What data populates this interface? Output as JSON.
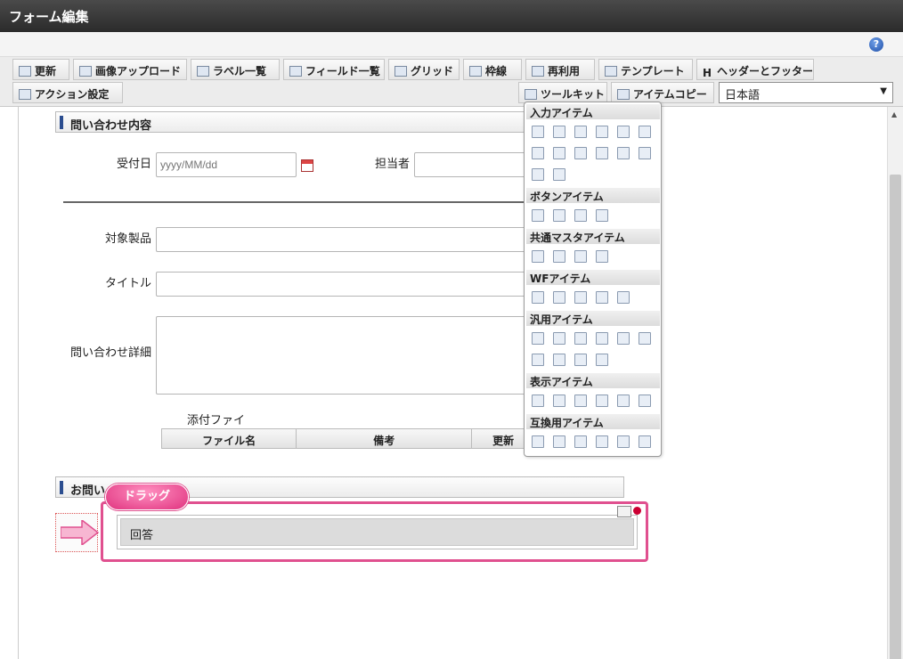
{
  "window": {
    "title": "フォーム編集"
  },
  "toolbar": {
    "row1": [
      {
        "label": "更新",
        "icon": "refresh-icon"
      },
      {
        "label": "画像アップロード",
        "icon": "image-upload-icon"
      },
      {
        "label": "ラベル一覧",
        "icon": "label-list-icon"
      },
      {
        "label": "フィールド一覧",
        "icon": "field-list-icon"
      },
      {
        "label": "グリッド",
        "icon": "grid-icon"
      },
      {
        "label": "枠線",
        "icon": "border-icon"
      },
      {
        "label": "再利用",
        "icon": "reuse-icon"
      },
      {
        "label": "テンプレート",
        "icon": "template-icon"
      },
      {
        "label": "ヘッダーとフッター",
        "icon": "header-footer-icon"
      }
    ],
    "row2_left": {
      "label": "アクション設定",
      "icon": "action-icon"
    },
    "toolkit": {
      "label": "ツールキット",
      "icon": "toolkit-icon"
    },
    "item_copy": {
      "label": "アイテムコピー",
      "icon": "item-copy-icon"
    },
    "language": {
      "selected": "日本語"
    }
  },
  "form": {
    "section1_title": "問い合わせ内容",
    "reception_date_label": "受付日",
    "reception_date_placeholder": "yyyy/MM/dd",
    "assignee_label": "担当者",
    "product_label": "対象製品",
    "title_label": "タイトル",
    "detail_label": "問い合わせ詳細",
    "attachment_label": "添付ファイル",
    "attachment_columns": [
      "ファイル名",
      "備考",
      "更新"
    ],
    "section2_title": "お問い",
    "answer_label": "回答"
  },
  "palette": {
    "groups": [
      {
        "title": "入力アイテム",
        "icons": [
          "text-box-icon",
          "text-box-alt-icon",
          "number-icon",
          "formula-icon",
          "date-icon",
          "date-range-icon",
          "select-icon",
          "list-icon",
          "checkbox-icon",
          "radio-icon",
          "pulldown-icon",
          "listbox-icon",
          "upload-icon",
          "table-icon"
        ]
      },
      {
        "title": "ボタンアイテム",
        "icons": [
          "button-check-icon",
          "button-next-icon",
          "button-back-icon",
          "button-return-icon"
        ]
      },
      {
        "title": "共通マスタアイテム",
        "icons": [
          "user-icon",
          "organization-icon",
          "role-icon",
          "public-group-icon"
        ]
      },
      {
        "title": "WFアイテム",
        "icons": [
          "clipboard-icon",
          "attachment-icon",
          "image-icon",
          "process-history-icon",
          "stamp-icon"
        ]
      },
      {
        "title": "汎用アイテム",
        "icons": [
          "divider-icon",
          "document-icon",
          "camera-icon",
          "key-icon",
          "import-icon",
          "export-icon",
          "panel-icon",
          "card-icon",
          "tree-icon",
          "calendar-icon"
        ]
      },
      {
        "title": "表示アイテム",
        "icons": [
          "label-item-icon",
          "hline-icon",
          "vline-icon",
          "rectangle-icon",
          "picture-icon",
          "text-icon"
        ]
      },
      {
        "title": "互換用アイテム",
        "icons": [
          "compat-select-icon",
          "compat-list-icon",
          "compat-checkbox-icon",
          "compat-radio-icon",
          "compat-pulldown-icon",
          "compat-listbox-icon"
        ]
      }
    ]
  },
  "drag": {
    "callout": "ドラッグ"
  }
}
